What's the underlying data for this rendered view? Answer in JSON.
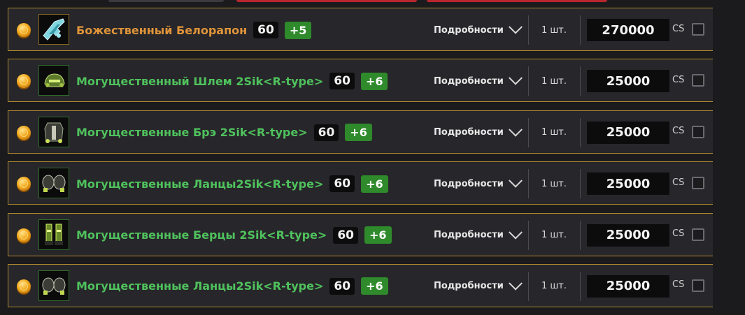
{
  "ui": {
    "details_label": "Подробности",
    "currency": "CS"
  },
  "items": [
    {
      "name": "Божественный Белорапон",
      "rarity": "divine",
      "level": "60",
      "bonus": "+5",
      "icon": "gun-icon",
      "qty": "1 шт.",
      "price": "270000"
    },
    {
      "name": "Могущественный Шлем 2Sik<R-type>",
      "rarity": "mighty",
      "level": "60",
      "bonus": "+6",
      "icon": "helmet-icon",
      "qty": "1 шт.",
      "price": "25000"
    },
    {
      "name": "Могущественные Брэ 2Sik<R-type>",
      "rarity": "mighty",
      "level": "60",
      "bonus": "+6",
      "icon": "body-armor-icon",
      "qty": "1 шт.",
      "price": "25000"
    },
    {
      "name": "Могущественные Ланцы2Sik<R-type>",
      "rarity": "mighty",
      "level": "60",
      "bonus": "+6",
      "icon": "gauntlets-icon",
      "qty": "1 шт.",
      "price": "25000"
    },
    {
      "name": "Могущественные Берцы 2Sik<R-type>",
      "rarity": "mighty",
      "level": "60",
      "bonus": "+6",
      "icon": "boots-icon",
      "qty": "1 шт.",
      "price": "25000"
    },
    {
      "name": "Могущественные Ланцы2Sik<R-type>",
      "rarity": "mighty",
      "level": "60",
      "bonus": "+6",
      "icon": "gauntlets-icon",
      "qty": "1 шт.",
      "price": "25000"
    }
  ],
  "colors": {
    "divine": "#e0953a",
    "mighty": "#4fc25d",
    "bonus_bg": "#2f8a2c",
    "row_border": "#b08a2e"
  }
}
